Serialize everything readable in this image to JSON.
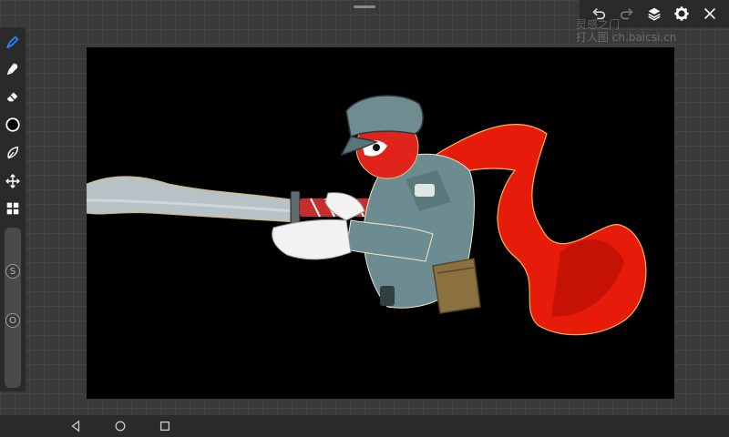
{
  "toolbar": {
    "tools": [
      {
        "name": "brush",
        "icon": "brush-icon",
        "active": true
      },
      {
        "name": "smudge",
        "icon": "smudge-icon"
      },
      {
        "name": "eraser",
        "icon": "eraser-icon"
      },
      {
        "name": "color",
        "icon": "color-swatch-icon",
        "color": "#000000"
      },
      {
        "name": "lasso",
        "icon": "lasso-icon"
      },
      {
        "name": "transform",
        "icon": "move-icon"
      },
      {
        "name": "adjust",
        "icon": "grid-icon"
      }
    ],
    "size_slider_label": "S",
    "opacity_slider_label": "O",
    "accent_color": "#1e88ff"
  },
  "topbar": {
    "undo": "undo-icon",
    "redo": "redo-icon",
    "layers": "layers-icon",
    "settings": "gear-icon",
    "close": "close-icon"
  },
  "watermark": {
    "line1": "灵感之门",
    "line2": "打人图 ch.baicsi.cn"
  },
  "navbar": {
    "back": "back-icon",
    "home": "home-icon",
    "recents": "recents-icon"
  }
}
